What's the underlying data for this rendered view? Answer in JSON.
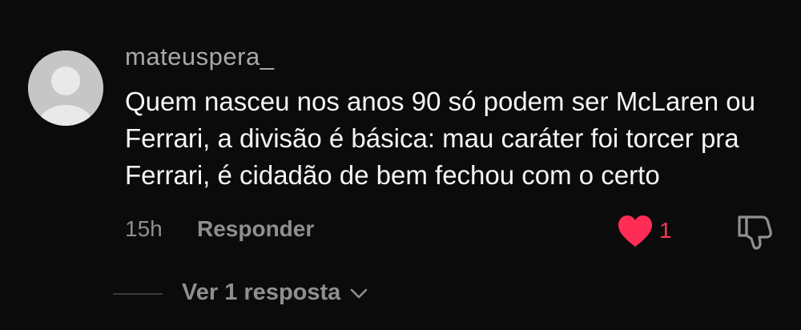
{
  "comment": {
    "username": "mateuspera_",
    "text": "Quem nasceu nos anos 90 só podem ser McLaren ou Ferrari, a divisão é básica: mau caráter foi torcer pra Ferrari, é cidadão de bem fechou com o certo",
    "time": "15h",
    "reply_label": "Responder",
    "likes": "1",
    "liked": true
  },
  "replies": {
    "label": "Ver 1 resposta"
  },
  "icons": {
    "avatar": "default-avatar-icon",
    "like": "heart-icon",
    "dislike": "thumbs-down-icon",
    "expand": "chevron-down-icon"
  },
  "colors": {
    "background": "#0b0b0c",
    "accent_like": "#ff2d55",
    "muted_text": "#8f8f8f"
  }
}
